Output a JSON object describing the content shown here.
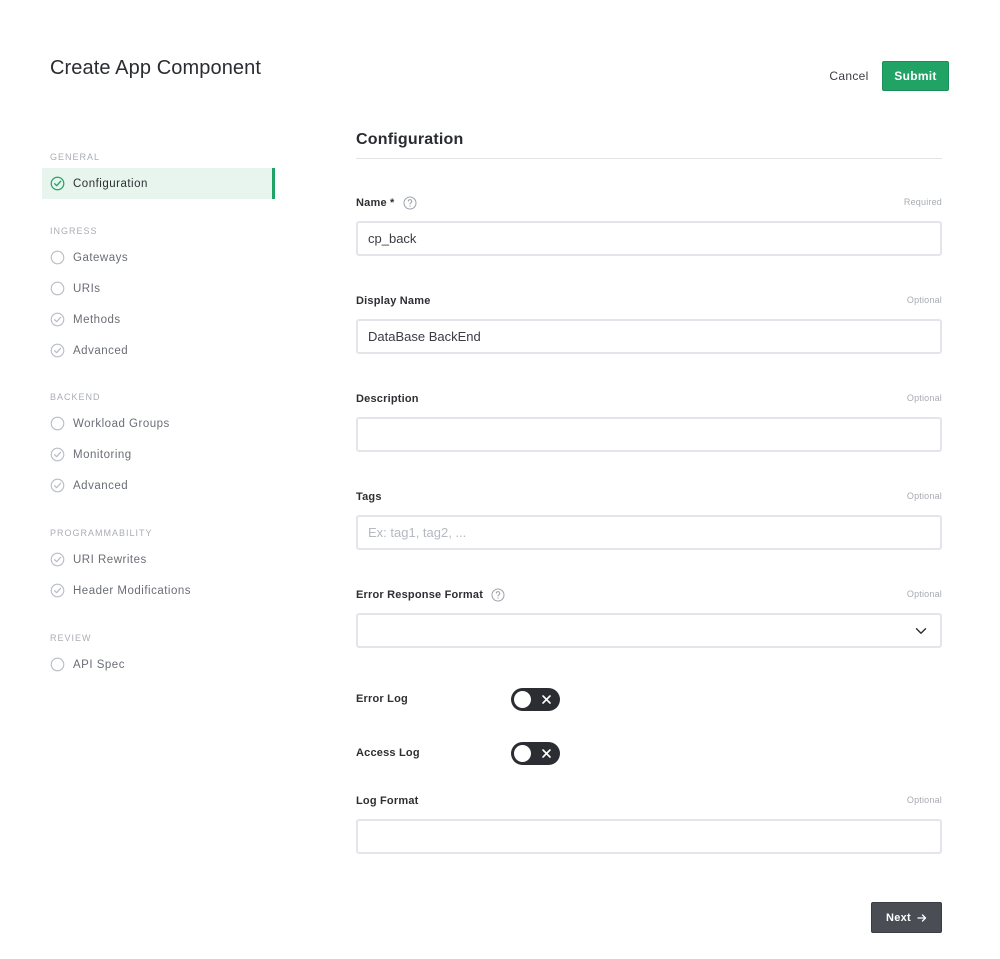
{
  "page": {
    "title": "Create App Component",
    "cancel_label": "Cancel",
    "submit_label": "Submit",
    "accent_color": "#21a366"
  },
  "sidebar": {
    "sections": [
      {
        "label": "GENERAL",
        "items": [
          {
            "label": "Configuration",
            "icon": "check-circle-icon",
            "state": "active"
          }
        ]
      },
      {
        "label": "INGRESS",
        "items": [
          {
            "label": "Gateways",
            "icon": "empty-circle-icon"
          },
          {
            "label": "URIs",
            "icon": "empty-circle-icon"
          },
          {
            "label": "Methods",
            "icon": "check-circle-icon"
          },
          {
            "label": "Advanced",
            "icon": "check-circle-icon"
          }
        ]
      },
      {
        "label": "BACKEND",
        "items": [
          {
            "label": "Workload Groups",
            "icon": "empty-circle-icon"
          },
          {
            "label": "Monitoring",
            "icon": "check-circle-icon"
          },
          {
            "label": "Advanced",
            "icon": "check-circle-icon"
          }
        ]
      },
      {
        "label": "PROGRAMMABILITY",
        "items": [
          {
            "label": "URI Rewrites",
            "icon": "check-circle-icon"
          },
          {
            "label": "Header Modifications",
            "icon": "check-circle-icon"
          }
        ]
      },
      {
        "label": "REVIEW",
        "items": [
          {
            "label": "API Spec",
            "icon": "empty-circle-icon"
          }
        ]
      }
    ]
  },
  "form": {
    "section_title": "Configuration",
    "name": {
      "label": "Name *",
      "hint": "Required",
      "value": "cp_back",
      "icon": "help-icon"
    },
    "display_name": {
      "label": "Display Name",
      "hint": "Optional",
      "value": "DataBase BackEnd"
    },
    "description": {
      "label": "Description",
      "hint": "Optional",
      "value": ""
    },
    "tags": {
      "label": "Tags",
      "hint": "Optional",
      "placeholder": "Ex: tag1, tag2, ..."
    },
    "error_response_format": {
      "label": "Error Response Format",
      "hint": "Optional",
      "value": "",
      "icon": "help-icon"
    },
    "error_log": {
      "label": "Error Log",
      "enabled": false
    },
    "access_log": {
      "label": "Access Log",
      "enabled": false
    },
    "log_format": {
      "label": "Log Format",
      "hint": "Optional",
      "value": ""
    },
    "next_label": "Next"
  }
}
